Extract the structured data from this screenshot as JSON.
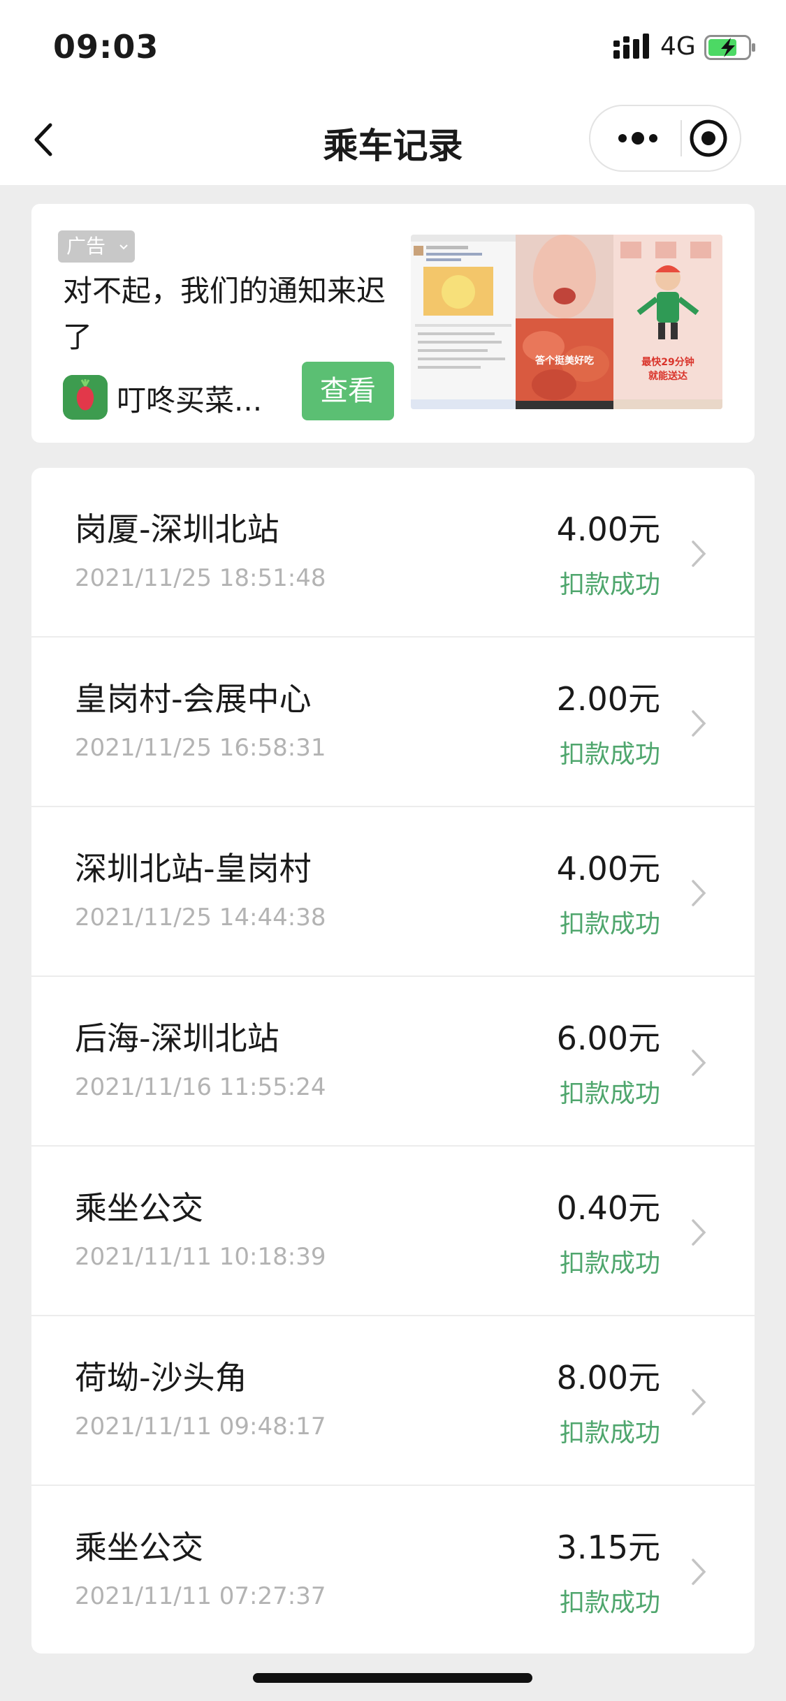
{
  "status_bar": {
    "time": "09:03",
    "network": "4G"
  },
  "nav": {
    "title": "乘车记录"
  },
  "ad": {
    "badge": "广告",
    "title": "对不起，我们的通知来迟了",
    "app_name": "叮咚买菜...",
    "button": "查看",
    "image_caption_1": "答个挺美好吃",
    "image_caption_2": "最快29分钟",
    "image_caption_3": "就能送达"
  },
  "records": [
    {
      "route": "岗厦-深圳北站",
      "time": "2021/11/25 18:51:48",
      "amount": "4.00元",
      "status": "扣款成功"
    },
    {
      "route": "皇岗村-会展中心",
      "time": "2021/11/25 16:58:31",
      "amount": "2.00元",
      "status": "扣款成功"
    },
    {
      "route": "深圳北站-皇岗村",
      "time": "2021/11/25 14:44:38",
      "amount": "4.00元",
      "status": "扣款成功"
    },
    {
      "route": "后海-深圳北站",
      "time": "2021/11/16 11:55:24",
      "amount": "6.00元",
      "status": "扣款成功"
    },
    {
      "route": "乘坐公交",
      "time": "2021/11/11 10:18:39",
      "amount": "0.40元",
      "status": "扣款成功"
    },
    {
      "route": "荷坳-沙头角",
      "time": "2021/11/11 09:48:17",
      "amount": "8.00元",
      "status": "扣款成功"
    },
    {
      "route": "乘坐公交",
      "time": "2021/11/11 07:27:37",
      "amount": "3.15元",
      "status": "扣款成功"
    }
  ],
  "colors": {
    "status_success": "#4fa66d",
    "ad_button": "#5bbf73",
    "background": "#ededed"
  }
}
